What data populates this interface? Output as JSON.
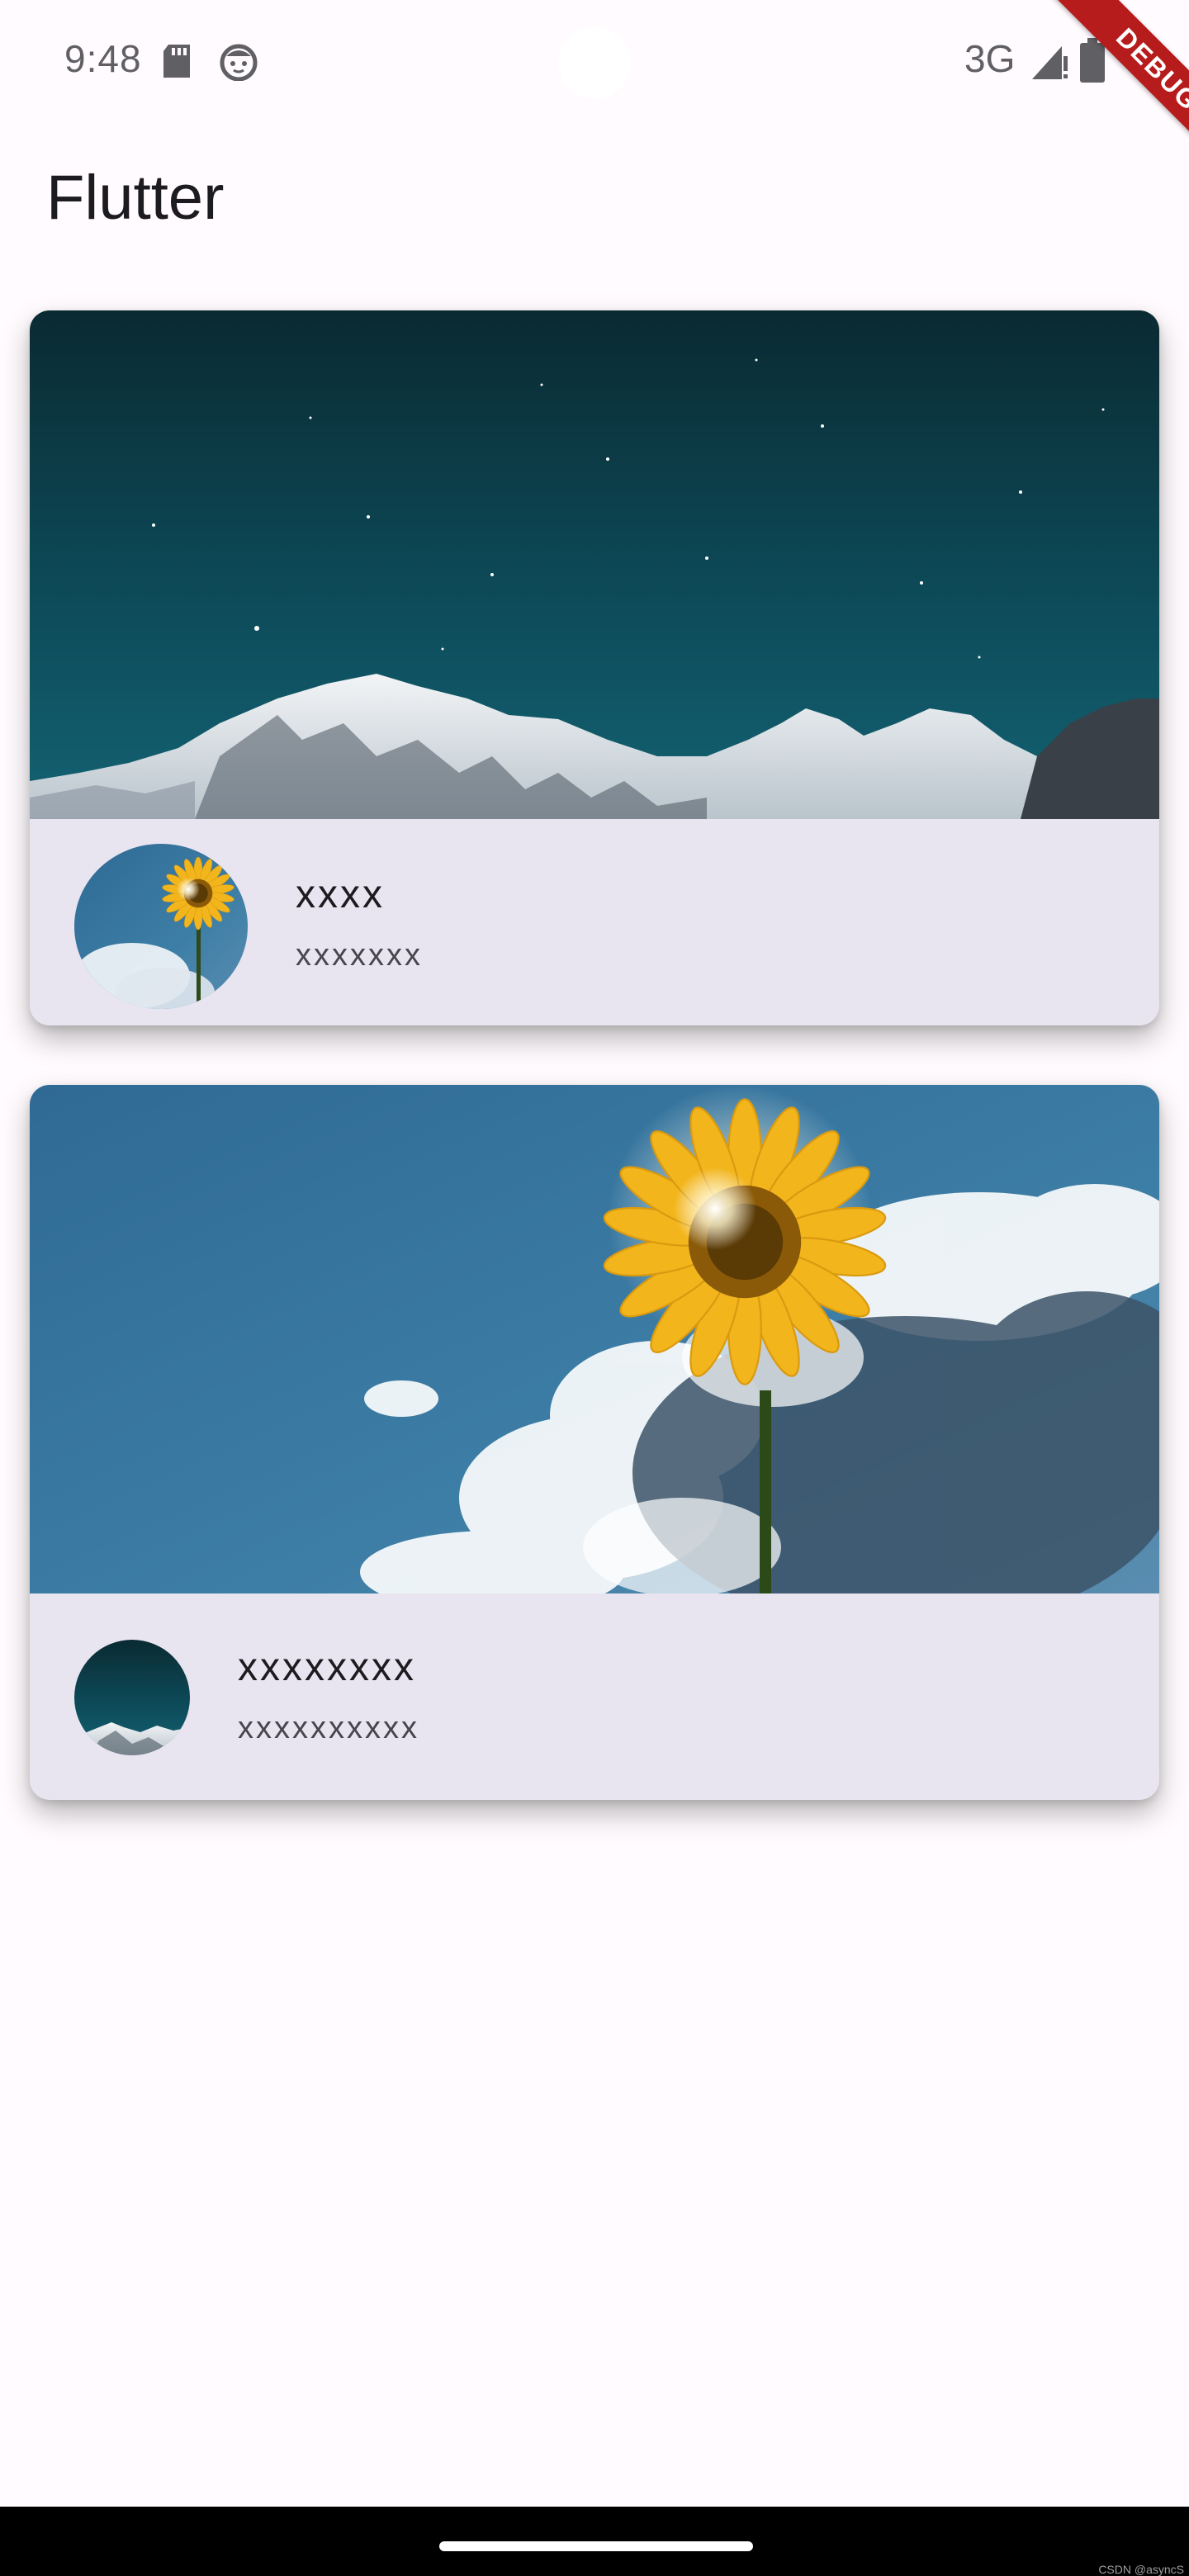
{
  "status_bar": {
    "time": "9:48",
    "network": "3G",
    "icons": [
      "sd-card-icon",
      "face-icon",
      "signal-icon",
      "battery-icon"
    ]
  },
  "debug_banner": {
    "label": "DEBUG",
    "color": "#b71c1c"
  },
  "app_bar": {
    "title": "Flutter"
  },
  "cards": [
    {
      "image": "snowy-mountains-night-sky",
      "avatar": "sunflower",
      "title": "xxxx",
      "subtitle": "xxxxxxx"
    },
    {
      "image": "sunflower-blue-sky",
      "avatar": "snowy-mountains-night-sky",
      "title": "xxxxxxxx",
      "subtitle": "xxxxxxxxxx"
    }
  ],
  "nav_bar": {
    "watermark": "CSDN @asyncS"
  },
  "colors": {
    "background": "#fffbfe",
    "card": "#e8e4f0",
    "title_text": "#1c1b1f",
    "subtitle_text": "#49454f"
  }
}
